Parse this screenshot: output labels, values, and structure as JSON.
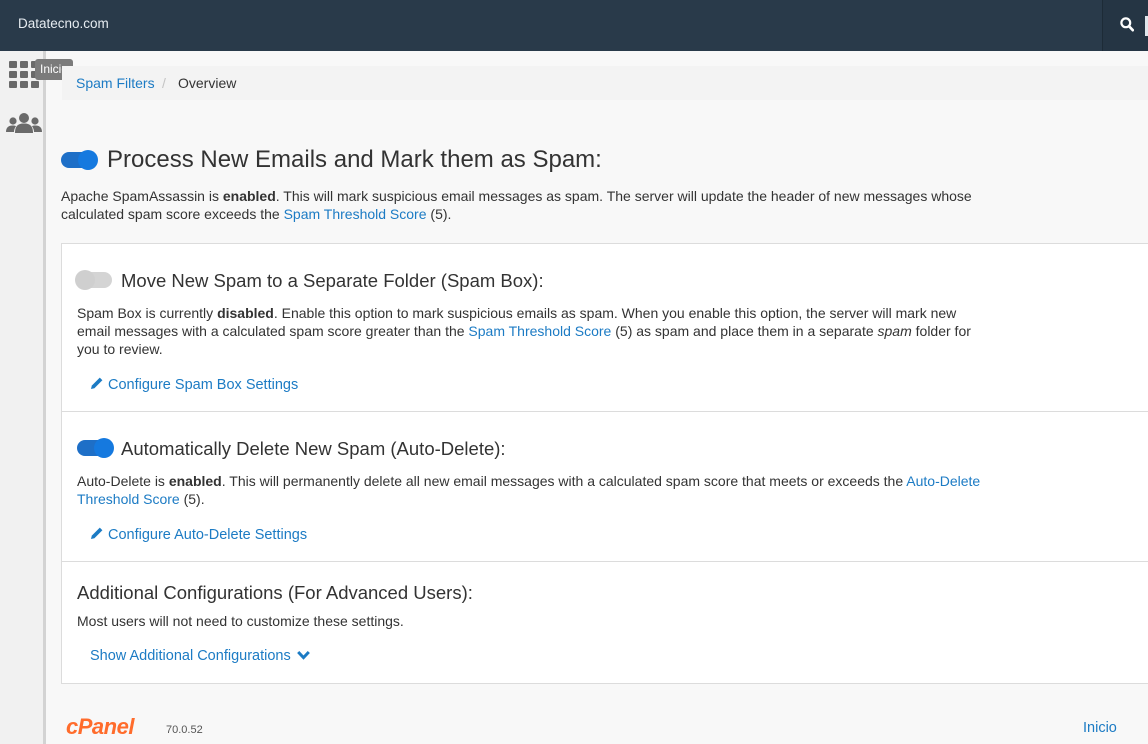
{
  "header": {
    "brand": "Datatecno.com"
  },
  "sidebar": {
    "tooltip": "Inicio"
  },
  "breadcrumb": {
    "parent": "Spam Filters",
    "separator": "/",
    "current": "Overview"
  },
  "main": {
    "toggle_on": true,
    "title": "Process New Emails and Mark them as Spam:",
    "desc_1": "Apache SpamAssassin is ",
    "desc_bold": "enabled",
    "desc_2": ". This will mark suspicious email messages as spam. The server will update the header of new messages whose calculated spam score exceeds the ",
    "desc_link": "Spam Threshold Score",
    "desc_3": " (5)."
  },
  "spam_box": {
    "toggle_on": false,
    "title": "Move New Spam to a Separate Folder (Spam Box):",
    "desc_1": "Spam Box is currently ",
    "desc_bold": "disabled",
    "desc_2": ". Enable this option to mark suspicious emails as spam. When you enable this option, the server will mark new email messages with a calculated spam score greater than the ",
    "desc_link": "Spam Threshold Score",
    "desc_3": " (5) as spam and place them in a separate ",
    "desc_italic": "spam",
    "desc_4": " folder for you to review.",
    "action": "Configure Spam Box Settings"
  },
  "auto_delete": {
    "toggle_on": true,
    "title": "Automatically Delete New Spam (Auto-Delete):",
    "desc_1": "Auto-Delete is ",
    "desc_bold": "enabled",
    "desc_2": ". This will permanently delete all new email messages with a calculated spam score that meets or exceeds the ",
    "desc_link": "Auto-Delete Threshold Score",
    "desc_3": " (5).",
    "action": "Configure Auto-Delete Settings"
  },
  "additional": {
    "title": "Additional Configurations (For Advanced Users):",
    "desc": "Most users will not need to customize these settings.",
    "action": "Show Additional Configurations"
  },
  "footer": {
    "logo": "cPanel",
    "version": "70.0.52",
    "home_link": "Inicio"
  },
  "colors": {
    "topbar": "#293a4a",
    "link": "#1c7bc4",
    "toggle_on": "#1579df",
    "brand_orange": "#ff6c2c"
  }
}
